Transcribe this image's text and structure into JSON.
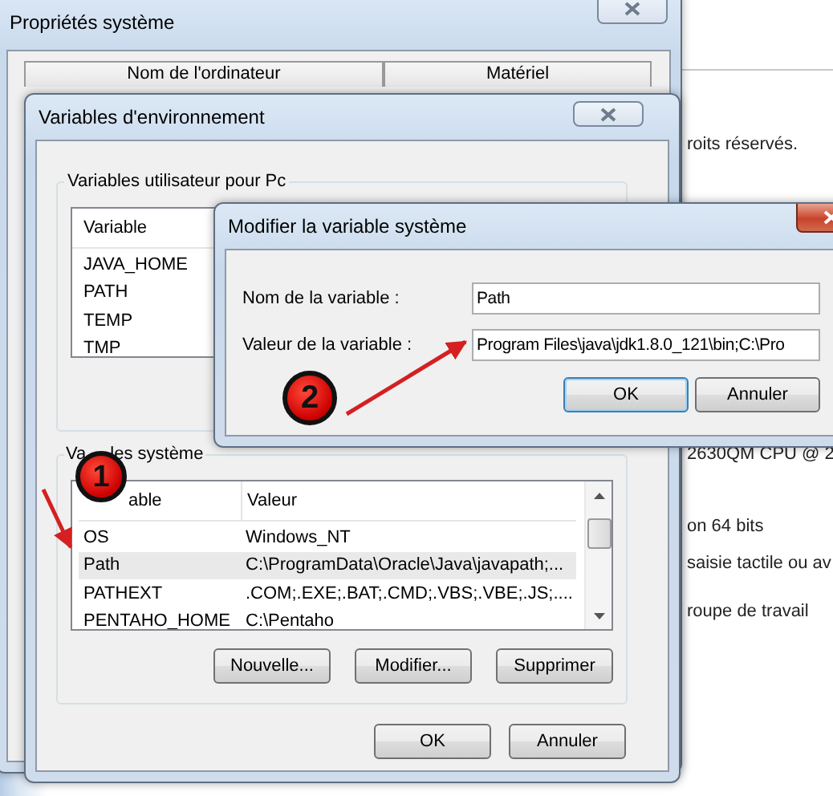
{
  "background_page": {
    "texts": [
      "roits réservés.",
      "2630QM CPU @ 2",
      "on 64 bits",
      "saisie tactile ou av",
      "roupe de travail"
    ]
  },
  "system_properties": {
    "title": "Propriétés système",
    "tabs": [
      {
        "label": "Nom de l'ordinateur"
      },
      {
        "label": "Matériel"
      }
    ]
  },
  "environment_variables": {
    "title": "Variables d'environnement",
    "user_variables": {
      "title": "Variables utilisateur pour Pc",
      "columns": [
        "Variable"
      ],
      "rows": [
        {
          "cells": [
            "JAVA_HOME"
          ],
          "selected": false
        },
        {
          "cells": [
            "PATH"
          ],
          "selected": false
        },
        {
          "cells": [
            "TEMP"
          ],
          "selected": false
        },
        {
          "cells": [
            "TMP"
          ],
          "selected": false
        }
      ]
    },
    "system_variables": {
      "title_parts": [
        "Va",
        "les système"
      ],
      "columns": [
        "able",
        "Valeur"
      ],
      "rows": [
        {
          "cells": [
            "OS",
            "Windows_NT"
          ],
          "selected": false
        },
        {
          "cells": [
            "Path",
            "C:\\ProgramData\\Oracle\\Java\\javapath;..."
          ],
          "selected": true
        },
        {
          "cells": [
            "PATHEXT",
            ".COM;.EXE;.BAT;.CMD;.VBS;.VBE;.JS;...."
          ],
          "selected": false
        },
        {
          "cells": [
            "PENTAHO_HOME",
            "C:\\Pentaho"
          ],
          "selected": false
        }
      ]
    },
    "list_buttons": [
      "Nouvelle...",
      "Modifier...",
      "Supprimer"
    ],
    "buttons": [
      "OK",
      "Annuler"
    ]
  },
  "edit_dialog": {
    "title": "Modifier la variable système",
    "fields": [
      {
        "label": "Nom de la variable :",
        "value": "Path"
      },
      {
        "label": "Valeur de la variable :",
        "value": "Program Files\\java\\jdk1.8.0_121\\bin;C:\\Pro"
      }
    ],
    "buttons": [
      "OK",
      "Annuler"
    ]
  },
  "annotations": [
    {
      "label": "1"
    },
    {
      "label": "2"
    }
  ]
}
